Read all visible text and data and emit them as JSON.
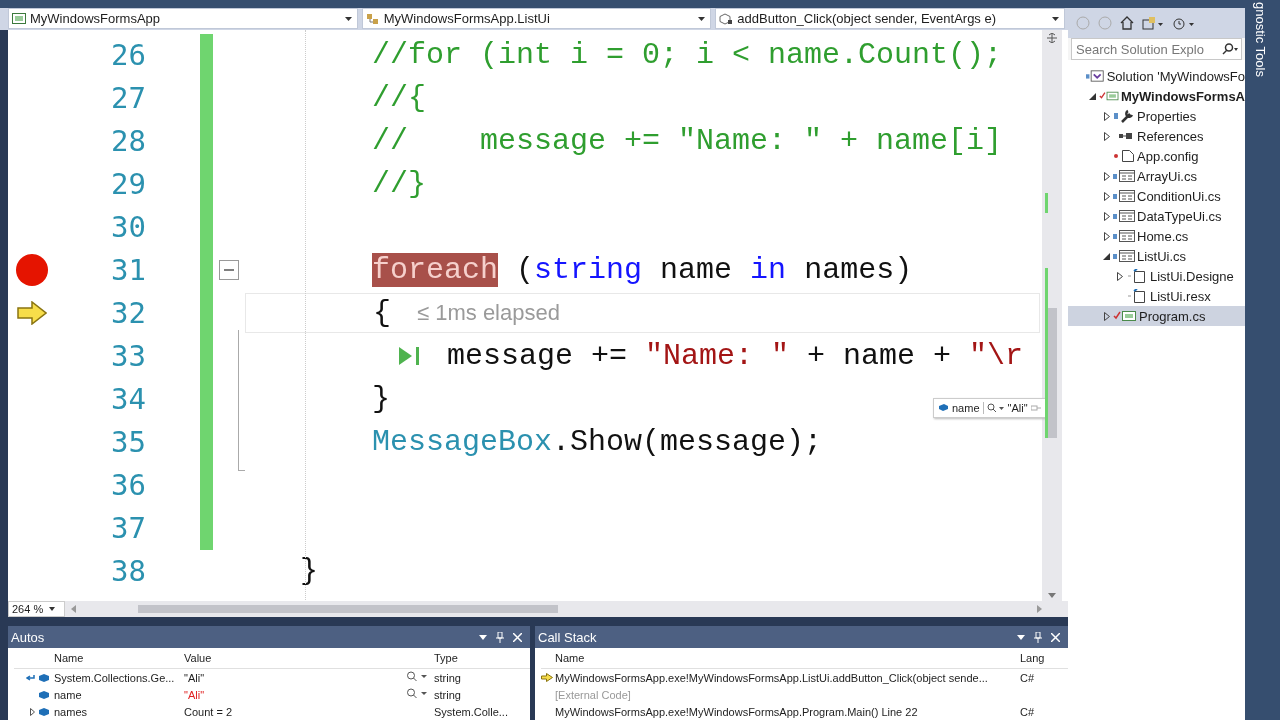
{
  "navbar": {
    "project": "MyWindowsFormsApp",
    "type": "MyWindowsFormsApp.ListUi",
    "member": "addButton_Click(object sender, EventArgs e)"
  },
  "editor": {
    "lines": [
      {
        "number": "26",
        "kind": "body",
        "changed": true,
        "breakpoint": false,
        "current": false,
        "collapsible": false,
        "run_to_click": false,
        "code": [
          {
            "t": "//for (int i = 0; i < name.Count();",
            "kind": "comment"
          }
        ]
      },
      {
        "number": "27",
        "kind": "body",
        "changed": true,
        "breakpoint": false,
        "current": false,
        "collapsible": false,
        "run_to_click": false,
        "code": [
          {
            "t": "//{",
            "kind": "comment"
          }
        ]
      },
      {
        "number": "28",
        "kind": "body",
        "changed": true,
        "breakpoint": false,
        "current": false,
        "collapsible": false,
        "run_to_click": false,
        "code": [
          {
            "t": "//    message += \"Name: \" + name[i]",
            "kind": "comment"
          }
        ]
      },
      {
        "number": "29",
        "kind": "body",
        "changed": true,
        "breakpoint": false,
        "current": false,
        "collapsible": false,
        "run_to_click": false,
        "code": [
          {
            "t": "//}",
            "kind": "comment"
          }
        ]
      },
      {
        "number": "30",
        "kind": "body",
        "changed": true,
        "breakpoint": false,
        "current": false,
        "collapsible": false,
        "run_to_click": false
      },
      {
        "number": "31",
        "kind": "body",
        "changed": true,
        "breakpoint": true,
        "current": false,
        "collapsible": true,
        "run_to_click": false,
        "code": [
          {
            "t": "foreach",
            "kind": "hit"
          },
          {
            "t": " (",
            "kind": "plain"
          },
          {
            "t": "string",
            "kind": "keyword"
          },
          {
            "t": " name ",
            "kind": "plain"
          },
          {
            "t": "in",
            "kind": "keyword"
          },
          {
            "t": " names)",
            "kind": "plain"
          }
        ]
      },
      {
        "number": "32",
        "kind": "body",
        "changed": true,
        "breakpoint": false,
        "current": true,
        "collapsible": false,
        "run_to_click": false,
        "code": [
          {
            "t": "{",
            "kind": "plain"
          }
        ],
        "tip": "≤ 1ms elapsed"
      },
      {
        "number": "33",
        "kind": "inner",
        "changed": true,
        "breakpoint": false,
        "current": false,
        "collapsible": false,
        "run_to_click": true,
        "code": [
          {
            "t": "message += ",
            "kind": "plain"
          },
          {
            "t": "\"Name: \"",
            "kind": "string"
          },
          {
            "t": " + name + ",
            "kind": "plain"
          },
          {
            "t": "\"\\r",
            "kind": "string"
          }
        ]
      },
      {
        "number": "34",
        "kind": "body",
        "changed": true,
        "breakpoint": false,
        "current": false,
        "collapsible": false,
        "run_to_click": false,
        "code": [
          {
            "t": "}",
            "kind": "plain"
          }
        ]
      },
      {
        "number": "35",
        "kind": "body",
        "changed": true,
        "breakpoint": false,
        "current": false,
        "collapsible": false,
        "run_to_click": false,
        "code": [
          {
            "t": "MessageBox",
            "kind": "type"
          },
          {
            "t": ".Show(message);",
            "kind": "plain"
          }
        ]
      },
      {
        "number": "36",
        "kind": "body",
        "changed": true,
        "breakpoint": false,
        "current": false,
        "collapsible": false,
        "run_to_click": false
      },
      {
        "number": "37",
        "kind": "body",
        "changed": true,
        "breakpoint": false,
        "current": false,
        "collapsible": false,
        "run_to_click": false
      },
      {
        "number": "38",
        "kind": "outer",
        "changed": false,
        "breakpoint": false,
        "current": false,
        "collapsible": false,
        "run_to_click": false,
        "code": [
          {
            "t": "}",
            "kind": "plain"
          }
        ]
      }
    ],
    "datatip": {
      "name": "name",
      "value": "\"Ali\""
    },
    "zoom": "264 %"
  },
  "solution_explorer": {
    "search": {
      "placeholder": "Search Solution Explo"
    },
    "tree": [
      {
        "label": "Solution 'MyWindowsFo",
        "kind": "solution",
        "selected": false,
        "children": [
          {
            "label": "MyWindowsFormsA",
            "kind": "project",
            "expanded": true,
            "selected": false,
            "children": [
              {
                "label": "Properties",
                "kind": "properties",
                "expanded": false,
                "selected": false
              },
              {
                "label": "References",
                "kind": "references",
                "expanded": false,
                "selected": false
              },
              {
                "label": "App.config",
                "kind": "config",
                "selected": false
              },
              {
                "label": "ArrayUi.cs",
                "kind": "form",
                "expanded": false,
                "selected": false
              },
              {
                "label": "ConditionUi.cs",
                "kind": "form",
                "expanded": false,
                "selected": false
              },
              {
                "label": "DataTypeUi.cs",
                "kind": "form",
                "expanded": false,
                "selected": false
              },
              {
                "label": "Home.cs",
                "kind": "form",
                "expanded": false,
                "selected": false
              },
              {
                "label": "ListUi.cs",
                "kind": "form",
                "expanded": true,
                "selected": false,
                "children": [
                  {
                    "label": "ListUi.Designe",
                    "kind": "file",
                    "expanded": false,
                    "selected": false
                  },
                  {
                    "label": "ListUi.resx",
                    "kind": "file",
                    "selected": false
                  }
                ]
              },
              {
                "label": "Program.cs",
                "kind": "csharp",
                "expanded": false,
                "selected": true
              }
            ]
          }
        ]
      }
    ]
  },
  "side_tab": "gnostic Tools",
  "autos": {
    "title": "Autos",
    "columns": [
      "Name",
      "Value",
      "Type"
    ],
    "rows": [
      {
        "name": "System.Collections.Ge...",
        "value": "\"Ali\"",
        "type": "string",
        "changed": false,
        "returned": true,
        "expandable": false,
        "viewer": true
      },
      {
        "name": "name",
        "value": "\"Ali\"",
        "type": "string",
        "changed": true,
        "returned": false,
        "expandable": false,
        "viewer": true
      },
      {
        "name": "names",
        "value": "Count = 2",
        "type": "System.Colle...",
        "changed": false,
        "returned": false,
        "expandable": true,
        "viewer": false
      }
    ]
  },
  "call_stack": {
    "title": "Call Stack",
    "columns": [
      "Name",
      "Lang"
    ],
    "rows": [
      {
        "kind": "frame",
        "current": true,
        "name": "MyWindowsFormsApp.exe!MyWindowsFormsApp.ListUi.addButton_Click(object sende...",
        "lang": "C#"
      },
      {
        "kind": "external",
        "current": false,
        "name": "[External Code]"
      },
      {
        "kind": "frame",
        "current": false,
        "name": "MyWindowsFormsApp.exe!MyWindowsFormsApp.Program.Main() Line 22",
        "lang": "C#"
      }
    ]
  }
}
